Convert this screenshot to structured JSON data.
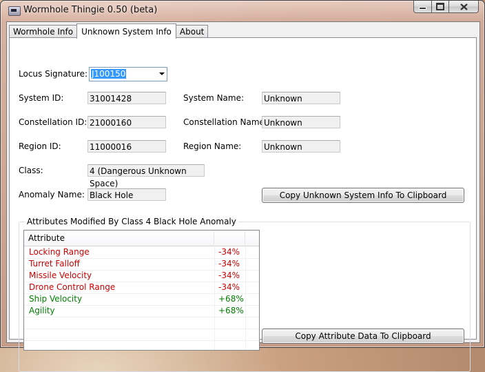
{
  "window": {
    "title": "Wormhole Thingie 0.50 (beta)"
  },
  "tabs": [
    {
      "label": "Wormhole Info",
      "active": false
    },
    {
      "label": "Unknown System Info",
      "active": true
    },
    {
      "label": "About",
      "active": false
    }
  ],
  "form": {
    "locus_signature_label": "Locus Signature:",
    "locus_signature_value": "J100150",
    "system_id_label": "System ID:",
    "system_id_value": "31001428",
    "system_name_label": "System Name:",
    "system_name_value": "Unknown",
    "constellation_id_label": "Constellation ID:",
    "constellation_id_value": "21000160",
    "constellation_name_label": "Constellation Name:",
    "constellation_name_value": "Unknown",
    "region_id_label": "Region ID:",
    "region_id_value": "11000016",
    "region_name_label": "Region Name:",
    "region_name_value": "Unknown",
    "class_label": "Class:",
    "class_value": "4 (Dangerous Unknown Space)",
    "anomaly_name_label": "Anomaly Name:",
    "anomaly_name_value": "Black Hole",
    "copy_system_button": "Copy Unknown System Info To Clipboard"
  },
  "attributes": {
    "group_title": "Attributes Modified By Class 4 Black Hole Anomaly",
    "column_header": "Attribute",
    "rows": [
      {
        "name": "Locking Range",
        "value": "-34%",
        "color": "#cc0000"
      },
      {
        "name": "Turret Falloff",
        "value": "-34%",
        "color": "#cc0000"
      },
      {
        "name": "Missile Velocity",
        "value": "-34%",
        "color": "#cc0000"
      },
      {
        "name": "Drone Control Range",
        "value": "-34%",
        "color": "#cc0000"
      },
      {
        "name": "Ship Velocity",
        "value": "+68%",
        "color": "#008000"
      },
      {
        "name": "Agility",
        "value": "+68%",
        "color": "#008000"
      }
    ],
    "copy_attributes_button": "Copy Attribute Data To Clipboard"
  }
}
